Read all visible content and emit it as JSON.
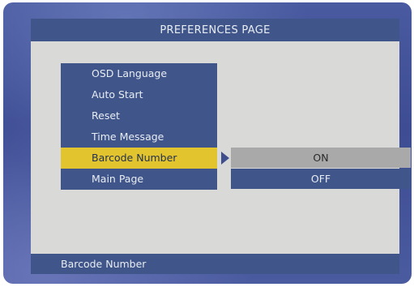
{
  "header": {
    "title": "PREFERENCES PAGE"
  },
  "menu": {
    "items": [
      {
        "label": "OSD Language"
      },
      {
        "label": "Auto Start"
      },
      {
        "label": "Reset"
      },
      {
        "label": "Time Message"
      },
      {
        "label": "Barcode Number",
        "selected": true
      },
      {
        "label": "Main Page"
      }
    ]
  },
  "options": {
    "items": [
      {
        "label": "ON",
        "highlighted": true
      },
      {
        "label": "OFF"
      }
    ]
  },
  "status": {
    "text": "Barcode Number"
  },
  "colors": {
    "bar": "#40568a",
    "panel": "#d9d9d7",
    "selection": "#e1c42e",
    "option_highlight": "#a9a9a9"
  },
  "icons": {
    "selection_pointer": "arrow-right-icon"
  }
}
